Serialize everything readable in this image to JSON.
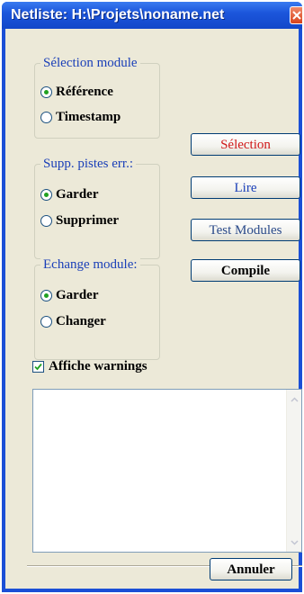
{
  "window": {
    "title": "Netliste: H:\\Projets\\noname.net"
  },
  "groups": {
    "selection_module": {
      "legend": "Sélection module",
      "options": [
        "Référence",
        "Timestamp"
      ],
      "selected": "Référence"
    },
    "supp_pistes": {
      "legend": "Supp. pistes err.:",
      "options": [
        "Garder",
        "Supprimer"
      ],
      "selected": "Garder"
    },
    "echange_module": {
      "legend": "Echange module:",
      "options": [
        "Garder",
        "Changer"
      ],
      "selected": "Garder"
    }
  },
  "buttons": {
    "selection": "Sélection",
    "lire": "Lire",
    "test_modules": "Test Modules",
    "compile": "Compile",
    "annuler": "Annuler"
  },
  "warnings_checkbox": {
    "label": "Affiche warnings",
    "checked": true
  },
  "messages": {
    "text": ""
  },
  "colors": {
    "title_bar": "#1c56dc",
    "legend_text": "#1a3fb8",
    "selection_button_text": "#d01818",
    "test_modules_button_text": "#2a4a8a",
    "radio_dot": "#21a121"
  }
}
